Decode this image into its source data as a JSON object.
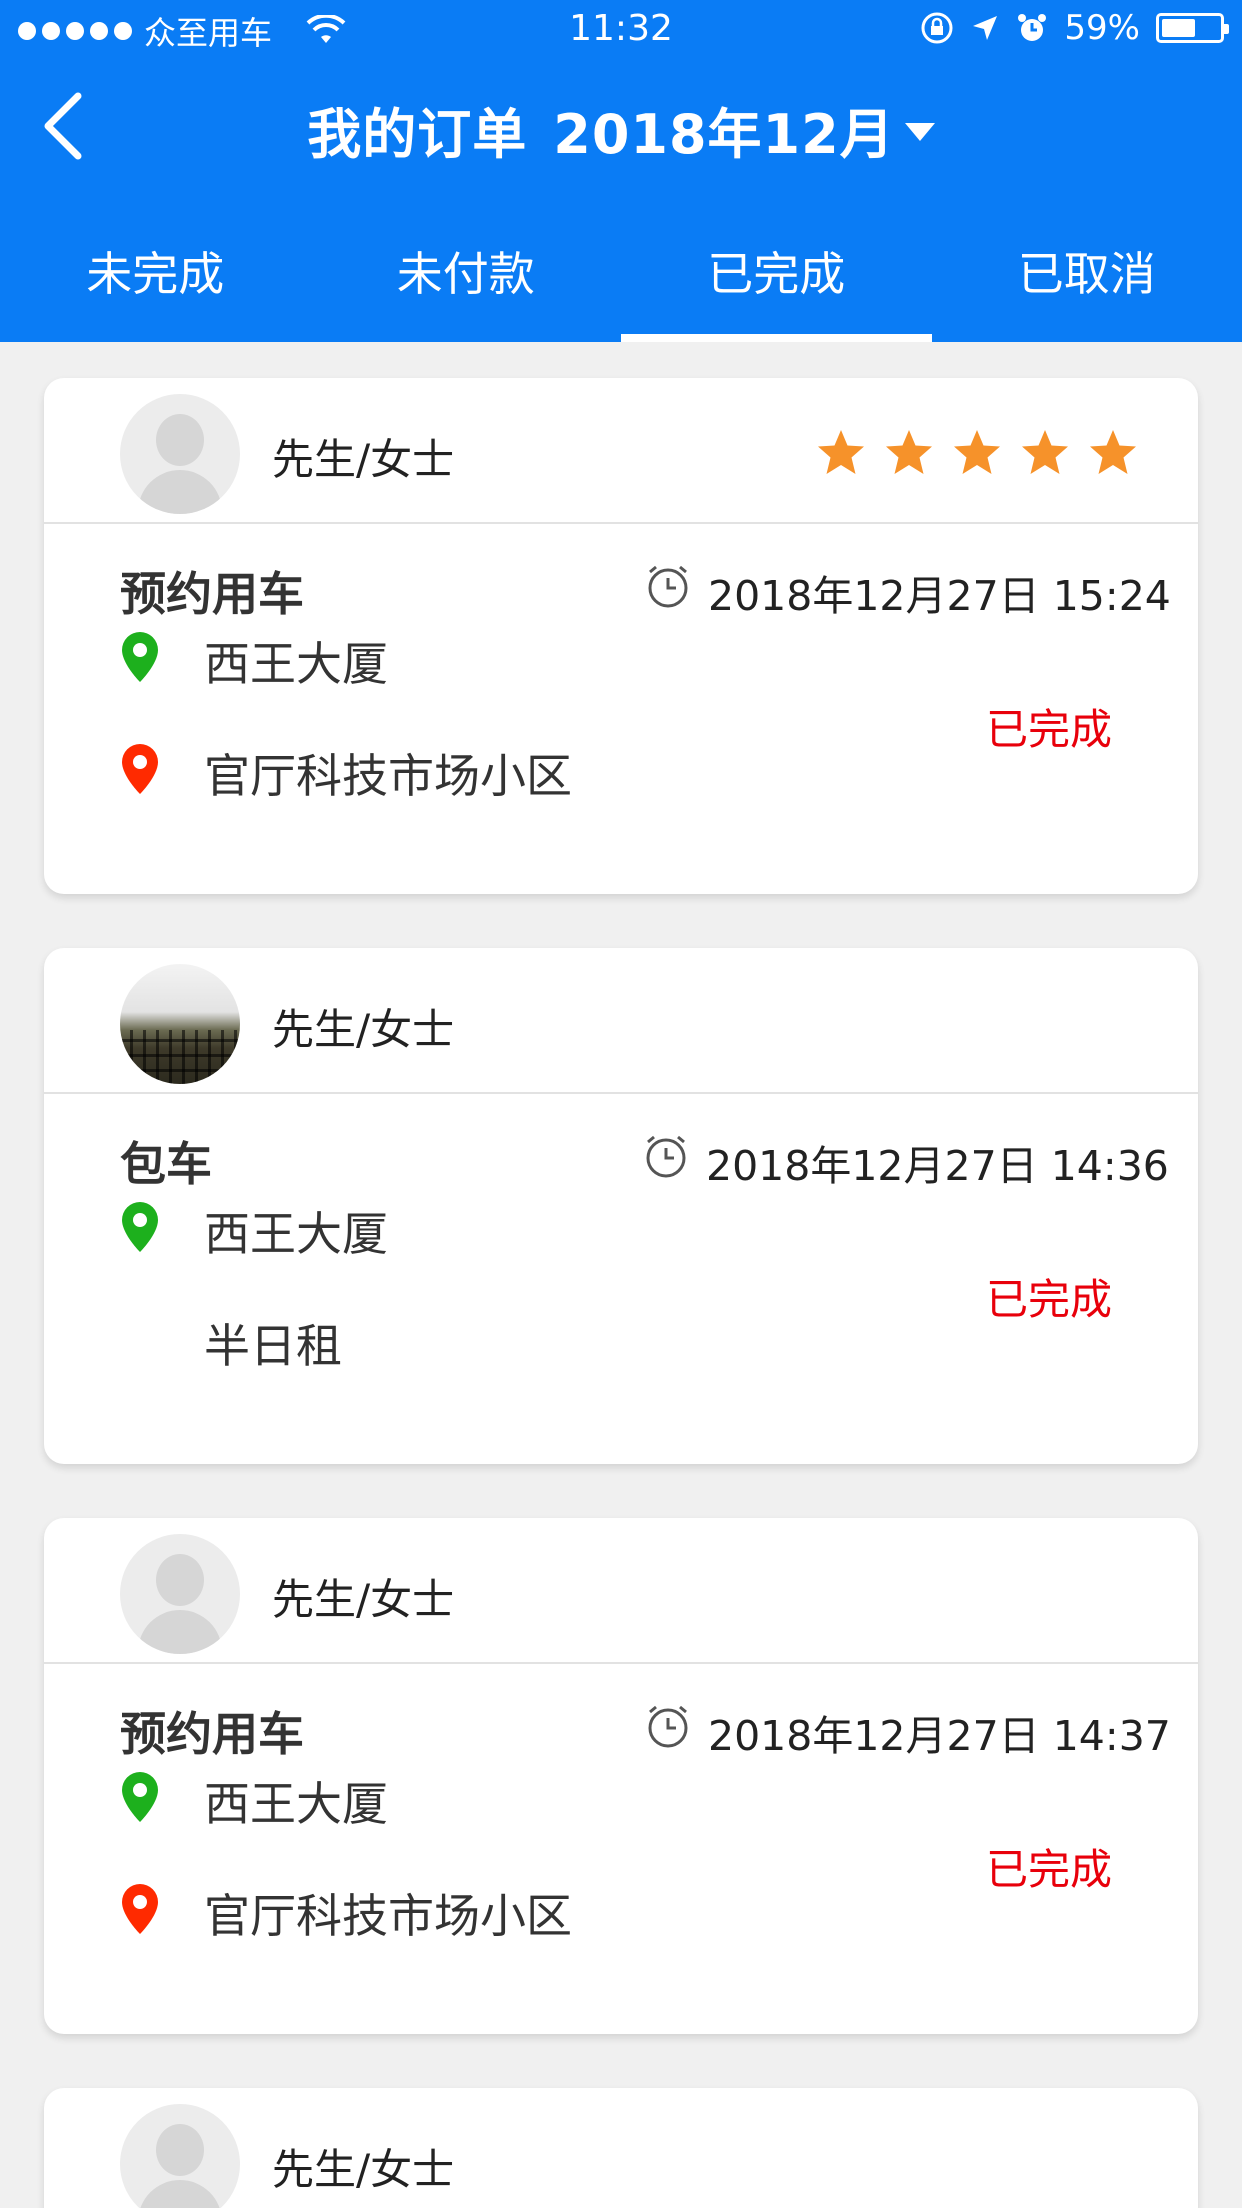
{
  "status_bar": {
    "carrier": "众至用车",
    "time": "11:32",
    "battery": "59%",
    "battery_level": 0.59
  },
  "nav": {
    "title": "我的订单",
    "month": "2018年12月"
  },
  "tabs": [
    {
      "label": "未完成",
      "active": false
    },
    {
      "label": "未付款",
      "active": false
    },
    {
      "label": "已完成",
      "active": true
    },
    {
      "label": "已取消",
      "active": false
    }
  ],
  "orders": [
    {
      "customer": "先生/女士",
      "avatar": "default",
      "rating": 5,
      "type": "预约用车",
      "time": "2018年12月27日 15:24",
      "line1": "西王大厦",
      "line2": "官厅科技市场小区",
      "status": "已完成"
    },
    {
      "customer": "先生/女士",
      "avatar": "photo",
      "type": "包车",
      "time": "2018年12月27日 14:36",
      "line1": "西王大厦",
      "line2": "半日租",
      "status": "已完成"
    },
    {
      "customer": "先生/女士",
      "avatar": "default",
      "type": "预约用车",
      "time": "2018年12月27日 14:37",
      "line1": "西王大厦",
      "line2": "官厅科技市场小区",
      "status": "已完成"
    },
    {
      "customer": "先生/女士",
      "avatar": "default"
    }
  ],
  "colors": {
    "primary": "#0a7cf5",
    "status_done": "#e8000b",
    "star": "#f6922a",
    "pin_start": "#1db01d",
    "pin_end": "#ff2a00"
  }
}
